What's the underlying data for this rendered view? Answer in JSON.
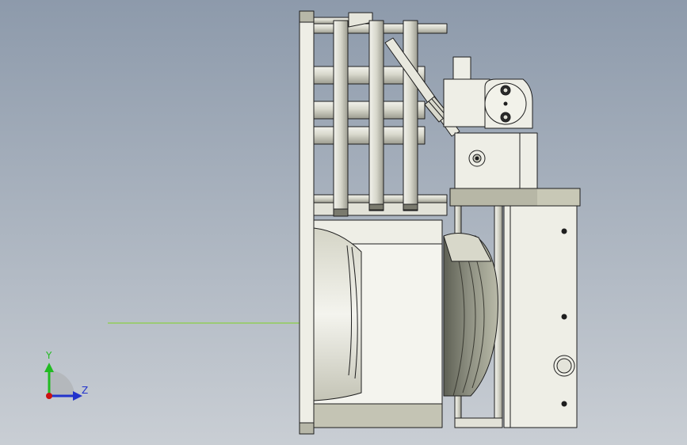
{
  "viewport": {
    "background_top": "#8d9aab",
    "background_bottom": "#c9ced4"
  },
  "triad": {
    "y_label": "Y",
    "z_label": "Z",
    "y_color": "#22bb22",
    "z_color": "#2233cc",
    "x_color": "#cc1111"
  },
  "guide_line_color": "#7ed321",
  "model": {
    "part_fill": "#eeeee6",
    "part_shade": "#d4d4c8",
    "dark_fill": "#b7b7a8",
    "outline": "#1e1e1e"
  }
}
